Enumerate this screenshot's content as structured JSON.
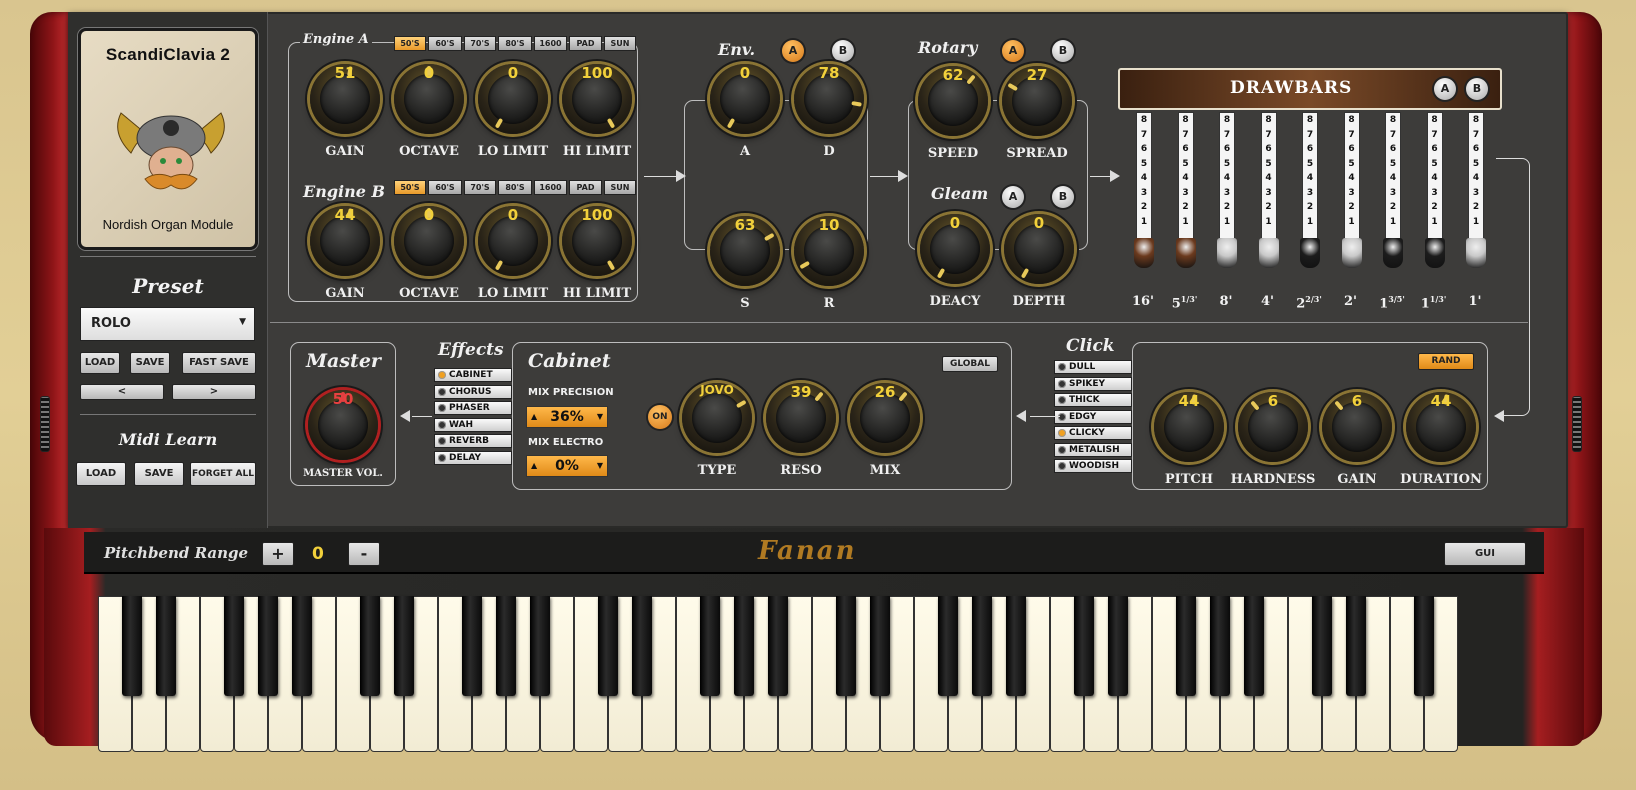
{
  "logo": {
    "title": "ScandiClavia 2",
    "subtitle": "Nordish Organ Module"
  },
  "preset": {
    "heading": "Preset",
    "selected": "ROLO",
    "load": "LOAD",
    "save": "SAVE",
    "fast_save": "FAST SAVE",
    "prev": "<",
    "next": ">"
  },
  "midi": {
    "heading": "Midi Learn",
    "load": "LOAD",
    "save": "SAVE",
    "forget": "FORGET ALL"
  },
  "engine_a": {
    "title": "Engine A",
    "tags": [
      "50'S",
      "60'S",
      "70'S",
      "80'S",
      "1600",
      "PAD",
      "SUN"
    ],
    "selected_tag": "50'S",
    "knobs": [
      {
        "label": "GAIN",
        "value": "51"
      },
      {
        "label": "OCTAVE",
        "value": "0"
      },
      {
        "label": "LO LIMIT",
        "value": "0"
      },
      {
        "label": "HI LIMIT",
        "value": "100"
      }
    ]
  },
  "engine_b": {
    "title": "Engine B",
    "tags": [
      "50'S",
      "60'S",
      "70'S",
      "80'S",
      "1600",
      "PAD",
      "SUN"
    ],
    "selected_tag": "50'S",
    "knobs": [
      {
        "label": "GAIN",
        "value": "44"
      },
      {
        "label": "OCTAVE",
        "value": "0"
      },
      {
        "label": "LO LIMIT",
        "value": "0"
      },
      {
        "label": "HI LIMIT",
        "value": "100"
      }
    ]
  },
  "env": {
    "title": "Env.",
    "a": "A",
    "b": "B",
    "knobs": [
      {
        "label": "A",
        "value": "0"
      },
      {
        "label": "D",
        "value": "78"
      },
      {
        "label": "S",
        "value": "63"
      },
      {
        "label": "R",
        "value": "10"
      }
    ]
  },
  "rotary": {
    "title": "Rotary",
    "a": "A",
    "b": "B",
    "knobs": [
      {
        "label": "SPEED",
        "value": "62"
      },
      {
        "label": "SPREAD",
        "value": "27"
      }
    ]
  },
  "gleam": {
    "title": "Gleam",
    "a": "A",
    "b": "B",
    "knobs": [
      {
        "label": "DEACY",
        "value": "0"
      },
      {
        "label": "DEPTH",
        "value": "0"
      }
    ]
  },
  "drawbars": {
    "title": "DRAWBARS",
    "a": "A",
    "b": "B",
    "numbers": [
      "8",
      "7",
      "6",
      "5",
      "4",
      "3",
      "2",
      "1"
    ],
    "bars": [
      {
        "label": "16'",
        "sup": "",
        "color": "#6b3a1e"
      },
      {
        "label": "5",
        "sup": "1/3'",
        "color": "#6b3a1e"
      },
      {
        "label": "8'",
        "sup": "",
        "color": "#c9c9c9"
      },
      {
        "label": "4'",
        "sup": "",
        "color": "#c9c9c9"
      },
      {
        "label": "2",
        "sup": "2/3'",
        "color": "#1c1c1c"
      },
      {
        "label": "2'",
        "sup": "",
        "color": "#c9c9c9"
      },
      {
        "label": "1",
        "sup": "3/5'",
        "color": "#1c1c1c"
      },
      {
        "label": "1",
        "sup": "1/3'",
        "color": "#1c1c1c"
      },
      {
        "label": "1'",
        "sup": "",
        "color": "#c9c9c9"
      }
    ]
  },
  "master": {
    "title": "Master",
    "label": "MASTER VOL.",
    "value": "50"
  },
  "effects": {
    "title": "Effects",
    "items": [
      "CABINET",
      "CHORUS",
      "PHASER",
      "WAH",
      "REVERB",
      "DELAY"
    ],
    "selected": "CABINET"
  },
  "cabinet": {
    "title": "Cabinet",
    "global": "GLOBAL",
    "mix_precision_label": "MIX PRECISION",
    "mix_precision": "36%",
    "mix_electro_label": "MIX ELECTRO",
    "mix_electro": "0%",
    "on": "ON",
    "knobs": [
      {
        "label": "TYPE",
        "value": "JOVO"
      },
      {
        "label": "RESO",
        "value": "39"
      },
      {
        "label": "MIX",
        "value": "26"
      }
    ]
  },
  "click": {
    "title": "Click",
    "rand": "RAND",
    "items": [
      "DULL",
      "SPIKEY",
      "THICK",
      "EDGY",
      "CLICKY",
      "METALISH",
      "WOODISH"
    ],
    "selected": "CLICKY",
    "knobs": [
      {
        "label": "PITCH",
        "value": "44"
      },
      {
        "label": "HARDNESS",
        "value": "6"
      },
      {
        "label": "GAIN",
        "value": "6"
      },
      {
        "label": "DURATION",
        "value": "44"
      }
    ]
  },
  "keyboard_bar": {
    "pitchbend_label": "Pitchbend Range",
    "plus": "+",
    "minus": "-",
    "value": "0",
    "brand": "Fanan",
    "gui": "GUI"
  },
  "colors": {
    "accent": "#f0a020",
    "knob_text": "#f1d03b",
    "panel": "#3d3c3a",
    "wood": "#a51e20"
  }
}
